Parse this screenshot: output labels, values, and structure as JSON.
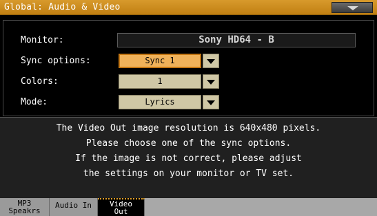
{
  "window": {
    "title": "Global: Audio & Video",
    "menu_icon": "chevron-down-icon"
  },
  "fields": {
    "monitor": {
      "label": "Monitor:",
      "value": "Sony HD64 - B"
    },
    "sync_options": {
      "label": "Sync options:",
      "value": "Sync 1"
    },
    "colors": {
      "label": "Colors:",
      "value": "1"
    },
    "mode": {
      "label": "Mode:",
      "value": "Lyrics"
    }
  },
  "info": {
    "lines": [
      "The Video Out image resolution is 640x480 pixels.",
      "Please choose one of the sync options.",
      "If the image is not correct, please adjust",
      "the settings on your monitor or TV set."
    ]
  },
  "tabs": [
    {
      "label_line1": "MP3",
      "label_line2": "Speakrs",
      "active": false
    },
    {
      "label_line1": "Audio In",
      "label_line2": "",
      "active": false
    },
    {
      "label_line1": "Video",
      "label_line2": "Out",
      "active": true
    }
  ],
  "colors": {
    "titlebar": "#c88a1c",
    "active_field": "#f0b25a",
    "field": "#cfc7a5",
    "tab_active_border": "#e3a12b"
  }
}
